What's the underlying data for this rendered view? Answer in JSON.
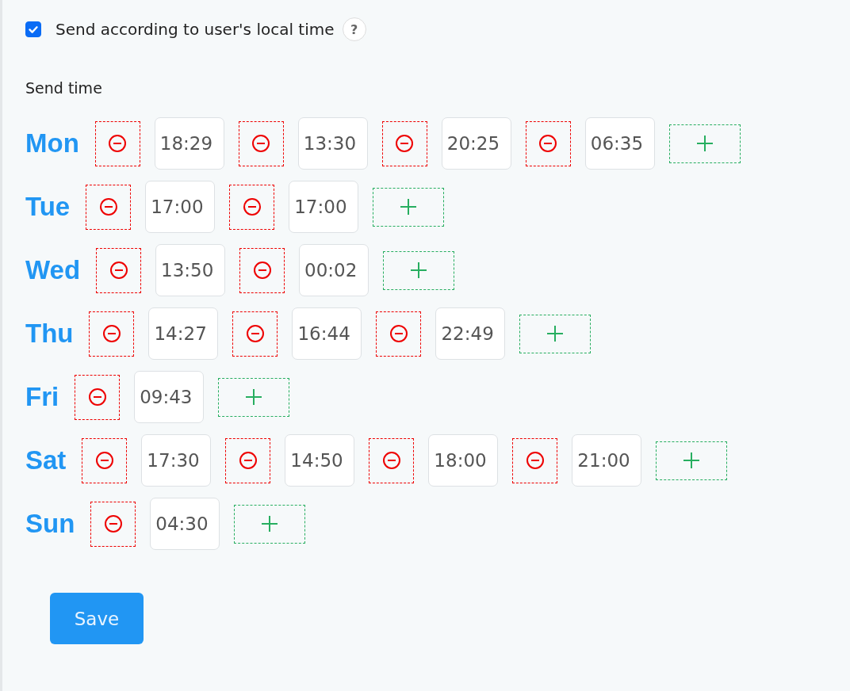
{
  "local_time": {
    "label": "Send according to user's local time",
    "checked": true,
    "help": "?"
  },
  "send_time": {
    "label": "Send time",
    "days": [
      {
        "day": "Mon",
        "times": [
          "18:29",
          "13:30",
          "20:25",
          "06:35"
        ]
      },
      {
        "day": "Tue",
        "times": [
          "17:00",
          "17:00"
        ]
      },
      {
        "day": "Wed",
        "times": [
          "13:50",
          "00:02"
        ]
      },
      {
        "day": "Thu",
        "times": [
          "14:27",
          "16:44",
          "22:49"
        ]
      },
      {
        "day": "Fri",
        "times": [
          "09:43"
        ]
      },
      {
        "day": "Sat",
        "times": [
          "17:30",
          "14:50",
          "18:00",
          "21:00"
        ]
      },
      {
        "day": "Sun",
        "times": [
          "04:30"
        ]
      }
    ]
  },
  "save": "Save"
}
